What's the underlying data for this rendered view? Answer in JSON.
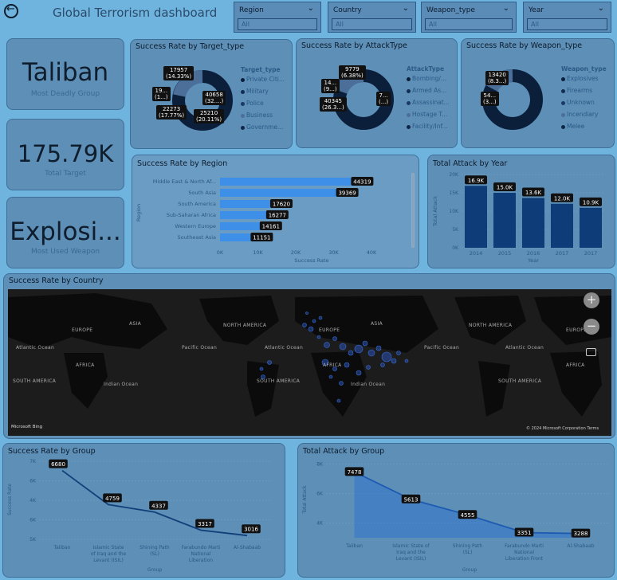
{
  "header": {
    "title": "Global Terrorism dashboard",
    "back_icon": "back-arrow-icon"
  },
  "slicers": [
    {
      "label": "Region",
      "value": "All"
    },
    {
      "label": "Country",
      "value": "All"
    },
    {
      "label": "Weapon_type",
      "value": "All"
    },
    {
      "label": "Year",
      "value": "All"
    }
  ],
  "kpis": [
    {
      "value": "Taliban",
      "label": "Most Deadly Group"
    },
    {
      "value": "175.79K",
      "label": "Total Target"
    },
    {
      "value": "Explosi...",
      "label": "Most Used Weapon"
    }
  ],
  "donut_target": {
    "title": "Success Rate by Target_type",
    "legend_title": "Target_type",
    "legend": [
      "Private Citi...",
      "Military",
      "Police",
      "Business",
      "Governme..."
    ],
    "labels": [
      {
        "text": "17957",
        "sub": "(14.33%)"
      },
      {
        "text": "19...",
        "sub": "(1...)"
      },
      {
        "text": "22273",
        "sub": "(17.77%)"
      },
      {
        "text": "25210",
        "sub": "(20.11%)"
      },
      {
        "text": "40658",
        "sub": "(32....)"
      }
    ]
  },
  "donut_attack": {
    "title": "Success Rate by AttackType",
    "legend_title": "AttackType",
    "legend": [
      "Bombing/...",
      "Armed As...",
      "Assassinat...",
      "Hostage T...",
      "Facility/Inf..."
    ],
    "labels": [
      {
        "text": "9779",
        "sub": "(6.38%)"
      },
      {
        "text": "14...",
        "sub": "(9...)"
      },
      {
        "text": "40345",
        "sub": "(26.3...)"
      },
      {
        "text": "7...",
        "sub": "(...)"
      }
    ]
  },
  "donut_weapon": {
    "title": "Success Rate by Weapon_type",
    "legend_title": "Weapon_type",
    "legend": [
      "Explosives",
      "Firearms",
      "Unknown",
      "Incendiary",
      "Melee"
    ],
    "labels": [
      {
        "text": "13420",
        "sub": "(8.3...)"
      },
      {
        "text": "54...",
        "sub": "(3...)"
      }
    ]
  },
  "region_chart": {
    "title": "Success Rate by Region",
    "xlabel": "Success Rate",
    "ylabel": "Region",
    "ticks": [
      "0K",
      "10K",
      "20K",
      "30K",
      "40K"
    ]
  },
  "year_chart": {
    "title": "Total Attack by Year",
    "xlabel": "Year",
    "ylabel": "Total Attack",
    "ticks": [
      "0K",
      "5K",
      "10K",
      "15K",
      "20K"
    ]
  },
  "map": {
    "title": "Success Rate by Country",
    "zoom_in": "+",
    "zoom_out": "−",
    "attribution_left": "Microsoft Bing",
    "attribution_right": "© 2024 Microsoft Corporation  Terms",
    "labels": [
      {
        "text": "ASIA"
      },
      {
        "text": "EUROPE"
      },
      {
        "text": "NORTH AMERICA"
      },
      {
        "text": "EUROPE"
      },
      {
        "text": "ASIA"
      },
      {
        "text": "NORTH AMERICA"
      },
      {
        "text": "EUROPE"
      },
      {
        "text": "Atlantic Ocean"
      },
      {
        "text": "Pacific Ocean"
      },
      {
        "text": "Atlantic Ocean"
      },
      {
        "text": "Pacific Ocean"
      },
      {
        "text": "Atlantic Ocean"
      },
      {
        "text": "AFRICA"
      },
      {
        "text": "Indian Ocean"
      },
      {
        "text": "AFRICA"
      },
      {
        "text": "Indian Ocean"
      },
      {
        "text": "AFRICA"
      },
      {
        "text": "SOUTH AMERICA"
      },
      {
        "text": "SOUTH AMERICA"
      },
      {
        "text": "SOUTH AMERICA"
      }
    ]
  },
  "group_success": {
    "title": "Success Rate by Group",
    "xlabel": "Group",
    "ylabel": "Success Rate",
    "ticks": [
      "5K",
      "6K",
      "4K",
      "6K",
      "7K"
    ]
  },
  "group_attack": {
    "title": "Total Attack by Group",
    "xlabel": "Group",
    "ylabel": "Total Attack",
    "ticks": [
      "4K",
      "6K",
      "8K"
    ]
  },
  "colors": {
    "background": "#6fb4de",
    "panel": "#5d8fb7",
    "donut_dark": "#0b1f3a",
    "bar_region": "#3d8fe8",
    "bar_year": "#0e3c78",
    "line": "#123f7a"
  },
  "chart_data": [
    {
      "type": "bar",
      "orientation": "horizontal",
      "title": "Success Rate by Region",
      "xlabel": "Success Rate",
      "ylabel": "Region",
      "categories": [
        "Middle East & North Af...",
        "South Asia",
        "South America",
        "Sub-Saharan Africa",
        "Western Europe",
        "Southeast Asia"
      ],
      "values": [
        44319,
        39369,
        17620,
        16277,
        14161,
        11151
      ],
      "xlim": [
        0,
        50000
      ]
    },
    {
      "type": "bar",
      "title": "Total Attack by Year",
      "xlabel": "Year",
      "ylabel": "Total Attack",
      "categories": [
        "2014",
        "2015",
        "2016",
        "2017",
        "2017"
      ],
      "values": [
        16900,
        15000,
        13600,
        12000,
        10900
      ],
      "data_labels": [
        "16.9K",
        "15.0K",
        "13.6K",
        "12.0K",
        "10.9K"
      ],
      "ylim": [
        0,
        20000
      ]
    },
    {
      "type": "line",
      "title": "Success Rate by Group",
      "xlabel": "Group",
      "ylabel": "Success Rate",
      "categories": [
        "Taliban",
        "Islamic State of Iraq and the Levant (ISIL)",
        "Shining Path (SL)",
        "Farabundo Marti National Liberation Fr...",
        "Al-Shabaab"
      ],
      "values": [
        6680,
        4759,
        4337,
        3317,
        3016
      ],
      "ylim": [
        2800,
        7200
      ]
    },
    {
      "type": "area",
      "title": "Total Attack by Group",
      "xlabel": "Group",
      "ylabel": "Total Attack",
      "categories": [
        "Taliban",
        "Islamic State of Iraq and the Levant (ISIL)",
        "Shining Path (SL)",
        "Farabundo Marti National Liberation Front",
        "Al-Shabaab"
      ],
      "values": [
        7478,
        5613,
        4555,
        3351,
        3288
      ],
      "ylim": [
        3000,
        8200
      ]
    }
  ]
}
